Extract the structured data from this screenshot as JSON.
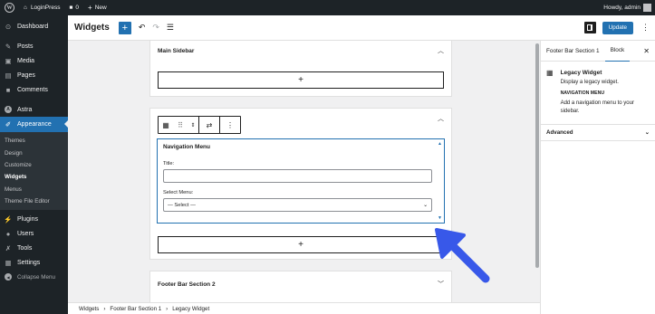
{
  "admin_bar": {
    "site_name": "LoginPress",
    "comments_count": "0",
    "new_label": "New",
    "greeting": "Howdy, admin"
  },
  "sidebar": {
    "items_top": [
      {
        "label": "Dashboard",
        "icon": "dashboard-icon",
        "glyph": "⊙"
      }
    ],
    "items_mid": [
      {
        "label": "Posts",
        "icon": "pin-icon",
        "glyph": "✎"
      },
      {
        "label": "Media",
        "icon": "media-icon",
        "glyph": "▣"
      },
      {
        "label": "Pages",
        "icon": "pages-icon",
        "glyph": "▤"
      },
      {
        "label": "Comments",
        "icon": "comment-icon",
        "glyph": "■"
      }
    ],
    "astra": {
      "label": "Astra",
      "icon": "astra-icon",
      "glyph": "A"
    },
    "appearance": {
      "label": "Appearance",
      "icon": "brush-icon",
      "glyph": "✐"
    },
    "submenu": [
      "Themes",
      "Design",
      "Customize",
      "Widgets",
      "Menus",
      "Theme File Editor"
    ],
    "submenu_active": "Widgets",
    "items_bottom": [
      {
        "label": "Plugins",
        "icon": "plugin-icon",
        "glyph": "⚡"
      },
      {
        "label": "Users",
        "icon": "user-icon",
        "glyph": "●"
      },
      {
        "label": "Tools",
        "icon": "wrench-icon",
        "glyph": "✗"
      },
      {
        "label": "Settings",
        "icon": "settings-icon",
        "glyph": "▦"
      }
    ],
    "collapse": {
      "label": "Collapse Menu",
      "icon": "collapse-icon",
      "glyph": "◀"
    }
  },
  "header": {
    "title": "Widgets",
    "update_label": "Update"
  },
  "canvas": {
    "main_sidebar_title": "Main Sidebar",
    "add_block": "+",
    "legacy_title": "Navigation Menu",
    "title_label": "Title:",
    "title_value": "",
    "select_menu_label": "Select Menu:",
    "select_value": "— Select —",
    "footer_section_2": "Footer Bar Section 2"
  },
  "settings": {
    "tab_area": "Footer Bar Section 1",
    "tab_block": "Block",
    "block_name": "Legacy Widget",
    "block_desc": "Display a legacy widget.",
    "widget_type": "NAVIGATION MENU",
    "widget_desc": "Add a navigation menu to your sidebar.",
    "advanced_label": "Advanced"
  },
  "breadcrumb": [
    "Widgets",
    "Footer Bar Section 1",
    "Legacy Widget"
  ],
  "colors": {
    "wp_blue": "#2271b1",
    "admin_dark": "#1d2327",
    "arrow_blue": "#3858e9"
  }
}
